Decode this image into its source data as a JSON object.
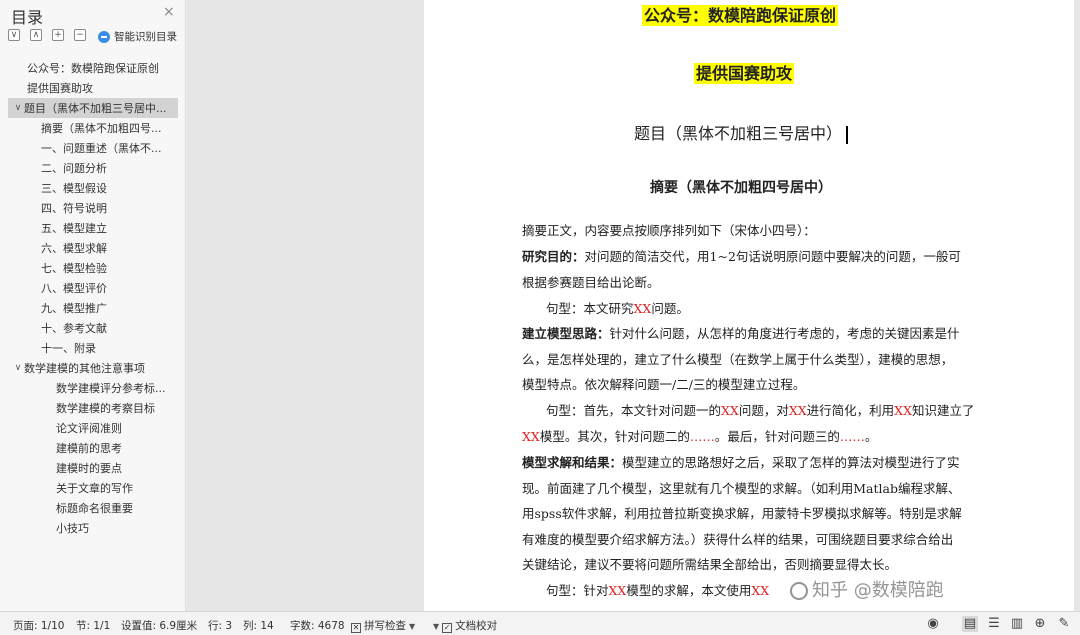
{
  "sidebar": {
    "title": "目录",
    "close": "×",
    "tools": [
      "∨",
      "∧",
      "+",
      "−"
    ],
    "smart_label": "智能识别目录",
    "items": [
      {
        "label": "公众号：数模陪跑保证原创",
        "level": "lv1"
      },
      {
        "label": "提供国赛助攻",
        "level": "lv1"
      },
      {
        "label": "题目（黑体不加粗三号居中...",
        "level": "lv1c",
        "selected": true
      },
      {
        "label": "摘要（黑体不加粗四号...",
        "level": "lv2"
      },
      {
        "label": "一、问题重述（黑体不...",
        "level": "lv2"
      },
      {
        "label": "二、问题分析",
        "level": "lv2"
      },
      {
        "label": "三、模型假设",
        "level": "lv2"
      },
      {
        "label": "四、符号说明",
        "level": "lv2"
      },
      {
        "label": "五、模型建立",
        "level": "lv2"
      },
      {
        "label": "六、模型求解",
        "level": "lv2"
      },
      {
        "label": "七、模型检验",
        "level": "lv2"
      },
      {
        "label": "八、模型评价",
        "level": "lv2"
      },
      {
        "label": "九、模型推广",
        "level": "lv2"
      },
      {
        "label": "十、参考文献",
        "level": "lv2"
      },
      {
        "label": "十一、附录",
        "level": "lv2"
      },
      {
        "label": "数学建模的其他注意事项",
        "level": "lv1c"
      },
      {
        "label": "数学建模评分参考标...",
        "level": "lv3"
      },
      {
        "label": "数学建模的考察目标",
        "level": "lv3"
      },
      {
        "label": "论文评阅准则",
        "level": "lv3"
      },
      {
        "label": "建模前的思考",
        "level": "lv3"
      },
      {
        "label": "建模时的要点",
        "level": "lv3"
      },
      {
        "label": "关于文章的写作",
        "level": "lv3"
      },
      {
        "label": "标题命名很重要",
        "level": "lv3"
      },
      {
        "label": "小技巧",
        "level": "lv3"
      }
    ]
  },
  "document": {
    "banner1": "公众号：数模陪跑保证原创",
    "banner2": "提供国赛助攻",
    "title": "题目（黑体不加粗三号居中）",
    "abstract_heading": "摘要（黑体不加粗四号居中）",
    "l01": "摘要正文，内容要点按顺序排列如下（宋体小四号）：",
    "l02_b": "研究目的：",
    "l02": "对问题的简洁交代，用1~2句话说明原问题中要解决的问题，一般可",
    "l03": "根据参赛题目给出论断。",
    "l04a": "句型：本文研究",
    "l04r": "XX",
    "l04b": "问题。",
    "l05_b": "建立模型思路：",
    "l05": "针对什么问题，从怎样的角度进行考虑的，考虑的关键因素是什",
    "l06": "么，是怎样处理的，建立了什么模型（在数学上属于什么类型），建模的思想，",
    "l07": "模型特点。依次解释问题一/二/三的模型建立过程。",
    "l08a": "句型：首先，本文针对问题一的",
    "l08r1": "XX",
    "l08b": "问题，对",
    "l08r2": "XX",
    "l08c": "进行简化，利用",
    "l08r3": "XX",
    "l08d": "知识建立了",
    "l09r1": "XX",
    "l09a": "模型。其次，针对问题二的",
    "l09r2": "……",
    "l09b": "。最后，针对问题三的",
    "l09r3": "……",
    "l09c": "。",
    "l10_b": "模型求解和结果：",
    "l10": "模型建立的思路想好之后，采取了怎样的算法对模型进行了实",
    "l11": "现。前面建了几个模型，这里就有几个模型的求解。（如利用Matlab编程求解、",
    "l12": "用spss软件求解，利用拉普拉斯变换求解，用蒙特卡罗模拟求解等。特别是求解",
    "l13": "有难度的模型要介绍求解方法。）获得什么样的结果，可围绕题目要求综合给出",
    "l14": "关键结论，建议不要将问题所需结果全部给出，否则摘要显得太长。",
    "l15a": "句型：针对",
    "l15r": "XX",
    "l15b": "模型的求解，本文使用",
    "l15r2": "XX"
  },
  "watermark": "知乎 @数模陪跑",
  "status": {
    "page": "页面: 1/10",
    "section": "节: 1/1",
    "setting": "设置值: 6.9厘米",
    "row": "行: 3",
    "col": "列: 14",
    "words": "字数: 4678",
    "spell": "拼写检查",
    "proof": "文档校对"
  },
  "view_icons": [
    "eye-icon",
    "page-view-icon",
    "outline-view-icon",
    "reading-view-icon",
    "web-view-icon",
    "pen-icon"
  ]
}
